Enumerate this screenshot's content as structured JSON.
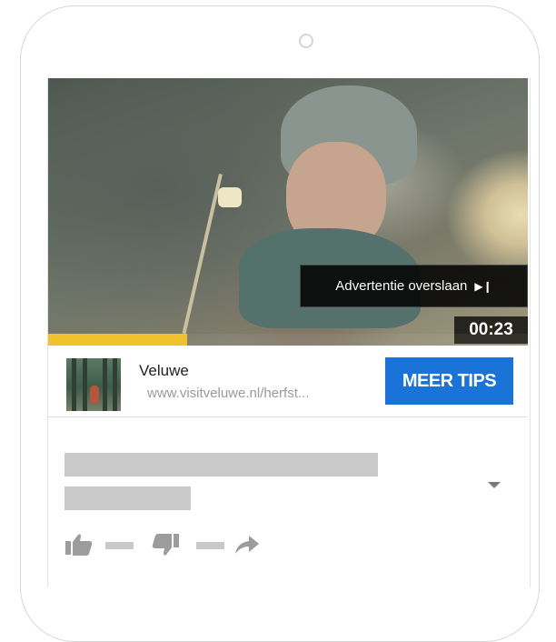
{
  "video": {
    "skip_label": "Advertentie overslaan",
    "skip_icon": "skip-next-icon",
    "timer": "00:23",
    "progress_fraction": 0.29,
    "progress_color": "#f2c12e"
  },
  "ad": {
    "title": "Veluwe",
    "url": "www.visitveluwe.nl/herfst...",
    "cta_label": "MEER TIPS",
    "cta_color": "#1a73d6"
  },
  "actions": {
    "like_icon": "thumbs-up-icon",
    "dislike_icon": "thumbs-down-icon",
    "share_icon": "share-arrow-icon",
    "expand_icon": "chevron-down-icon"
  }
}
